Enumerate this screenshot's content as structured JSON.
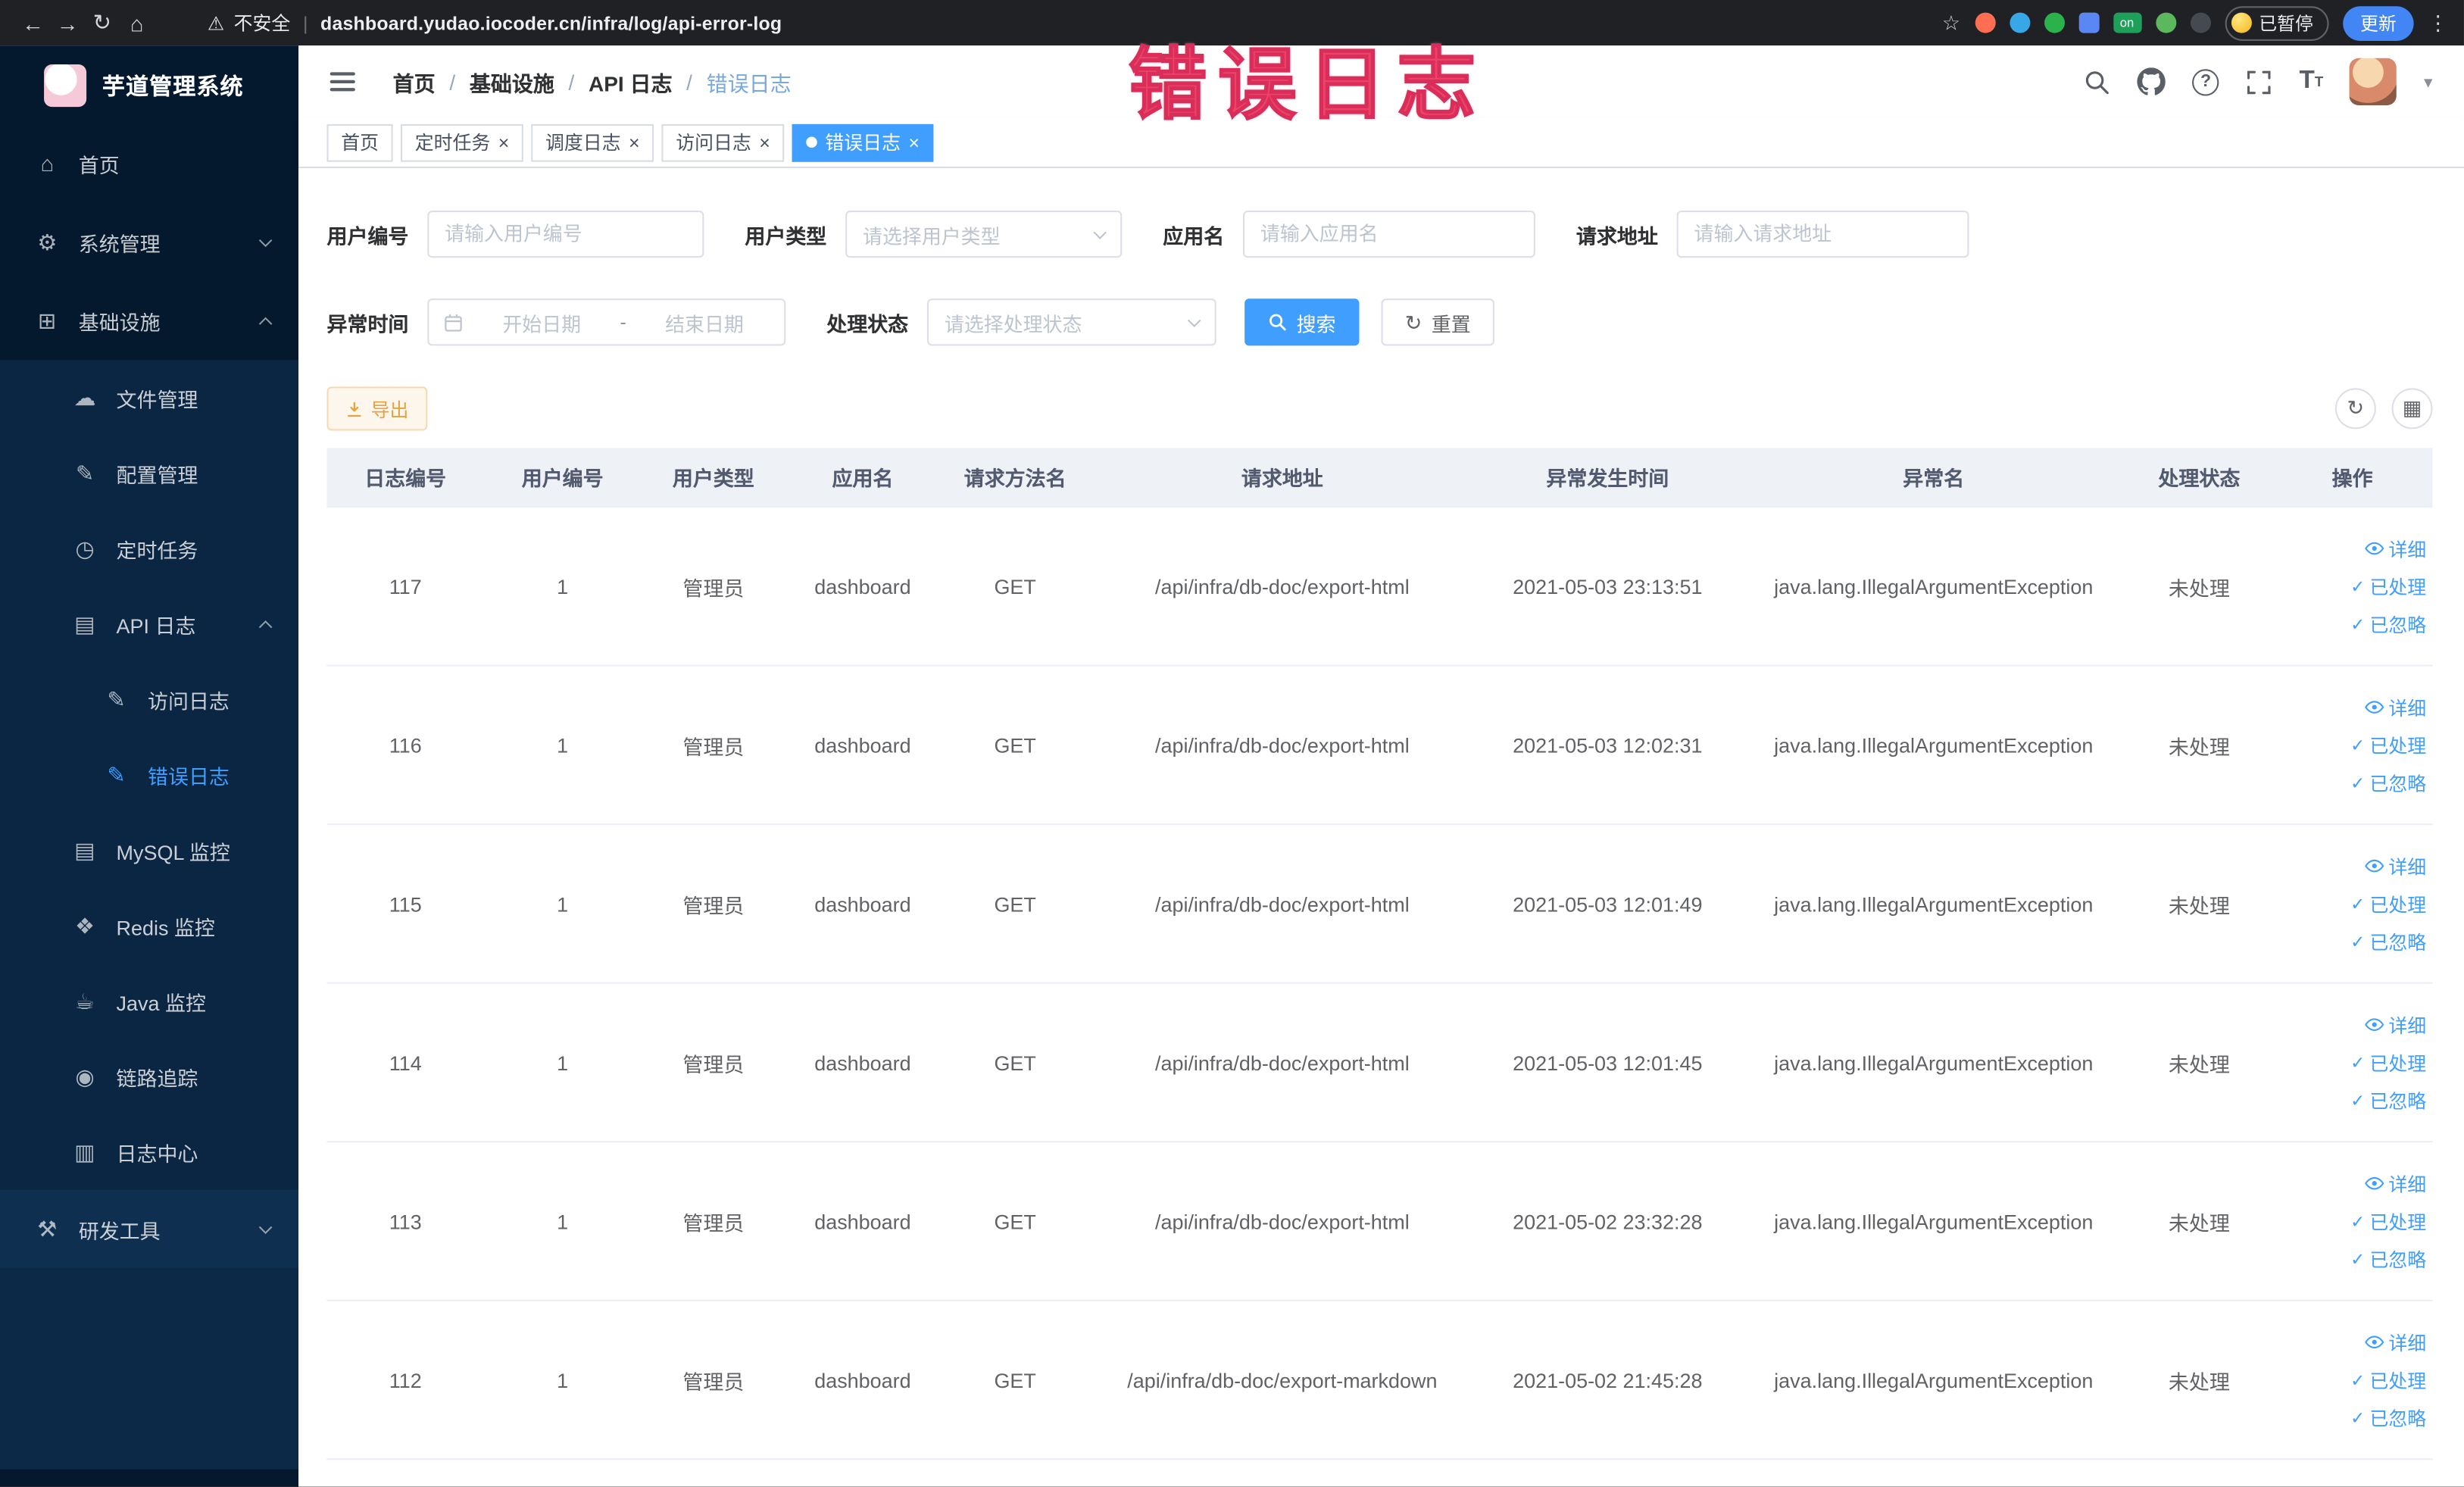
{
  "colors": {
    "primary": "#409eff",
    "warning": "#e6a23c",
    "annotation_red": "#ee4368",
    "sidebar_bg": "#04192e",
    "chrome_bg": "#202124",
    "active_tab_bg": "#409eff"
  },
  "icons": {
    "back": "←",
    "forward": "→",
    "reload": "↻",
    "home": "⌂",
    "warning": "⚠",
    "divider": "|",
    "star": "☆",
    "kebab": "⋮",
    "menu_home": "⌂",
    "gear": "⚙",
    "infra": "⊞",
    "cloud": "☁",
    "edit": "✎",
    "clock": "◷",
    "doc": "▤",
    "db": "▤",
    "redis": "❖",
    "coffee": "☕",
    "eye": "◉",
    "archive": "▥",
    "tools": "⚒",
    "check": "✓",
    "close": "×",
    "refresh": "↻",
    "columns": "▦",
    "question": "?",
    "caret": "▾",
    "fontsize_big": "T",
    "fontsize_small": "T"
  },
  "browser": {
    "security_label": "不安全",
    "url": "dashboard.yudao.iocoder.cn/infra/log/api-error-log",
    "paused_label": "已暂停",
    "update_label": "更新",
    "on_badge": "on"
  },
  "annotation": "错误日志",
  "sidebar": {
    "logo_title": "芋道管理系统",
    "home": "首页",
    "system": "系统管理",
    "infra": "基础设施",
    "file": "文件管理",
    "config": "配置管理",
    "job": "定时任务",
    "api_log": "API 日志",
    "access_log": "访问日志",
    "error_log": "错误日志",
    "mysql": "MySQL 监控",
    "redis": "Redis 监控",
    "java": "Java 监控",
    "trace": "链路追踪",
    "log_center": "日志中心",
    "devtools": "研发工具"
  },
  "header": {
    "breadcrumb": [
      "首页",
      "基础设施",
      "API 日志",
      "错误日志"
    ],
    "separator": "/"
  },
  "tabs": [
    {
      "label": "首页"
    },
    {
      "label": "定时任务"
    },
    {
      "label": "调度日志"
    },
    {
      "label": "访问日志"
    },
    {
      "label": "错误日志"
    }
  ],
  "filters": {
    "user_id_label": "用户编号",
    "user_id_placeholder": "请输入用户编号",
    "user_type_label": "用户类型",
    "user_type_placeholder": "请选择用户类型",
    "app_name_label": "应用名",
    "app_name_placeholder": "请输入应用名",
    "request_url_label": "请求地址",
    "request_url_placeholder": "请输入请求地址",
    "time_label": "异常时间",
    "time_start_placeholder": "开始日期",
    "range_separator": "-",
    "time_end_placeholder": "结束日期",
    "status_label": "处理状态",
    "status_placeholder": "请选择处理状态",
    "search_label": "搜索",
    "reset_label": "重置"
  },
  "toolbar": {
    "export_label": "导出"
  },
  "table": {
    "columns": [
      "日志编号",
      "用户编号",
      "用户类型",
      "应用名",
      "请求方法名",
      "请求地址",
      "异常发生时间",
      "异常名",
      "处理状态",
      "操作"
    ],
    "actions": [
      "详细",
      "已处理",
      "已忽略"
    ],
    "rows": [
      {
        "log_id": "117",
        "user_id": "1",
        "user_type": "管理员",
        "app": "dashboard",
        "method": "GET",
        "url": "/api/infra/db-doc/export-html",
        "time": "2021-05-03 23:13:51",
        "exception": "java.lang.IllegalArgumentException",
        "status": "未处理"
      },
      {
        "log_id": "116",
        "user_id": "1",
        "user_type": "管理员",
        "app": "dashboard",
        "method": "GET",
        "url": "/api/infra/db-doc/export-html",
        "time": "2021-05-03 12:02:31",
        "exception": "java.lang.IllegalArgumentException",
        "status": "未处理"
      },
      {
        "log_id": "115",
        "user_id": "1",
        "user_type": "管理员",
        "app": "dashboard",
        "method": "GET",
        "url": "/api/infra/db-doc/export-html",
        "time": "2021-05-03 12:01:49",
        "exception": "java.lang.IllegalArgumentException",
        "status": "未处理"
      },
      {
        "log_id": "114",
        "user_id": "1",
        "user_type": "管理员",
        "app": "dashboard",
        "method": "GET",
        "url": "/api/infra/db-doc/export-html",
        "time": "2021-05-03 12:01:45",
        "exception": "java.lang.IllegalArgumentException",
        "status": "未处理"
      },
      {
        "log_id": "113",
        "user_id": "1",
        "user_type": "管理员",
        "app": "dashboard",
        "method": "GET",
        "url": "/api/infra/db-doc/export-html",
        "time": "2021-05-02 23:32:28",
        "exception": "java.lang.IllegalArgumentException",
        "status": "未处理"
      },
      {
        "log_id": "112",
        "user_id": "1",
        "user_type": "管理员",
        "app": "dashboard",
        "method": "GET",
        "url": "/api/infra/db-doc/export-markdown",
        "time": "2021-05-02 21:45:28",
        "exception": "java.lang.IllegalArgumentException",
        "status": "未处理"
      }
    ]
  }
}
